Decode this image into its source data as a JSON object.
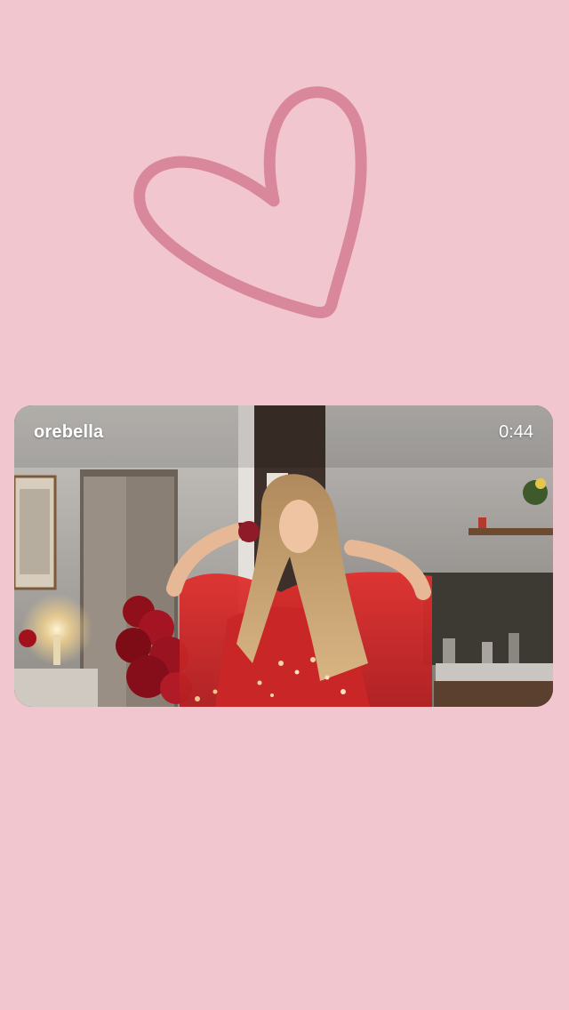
{
  "background_color": "#f2c6ce",
  "sticker": {
    "icon": "heart-outline-icon",
    "color": "#d9889c"
  },
  "video": {
    "username": "orebella",
    "duration": "0:44"
  }
}
